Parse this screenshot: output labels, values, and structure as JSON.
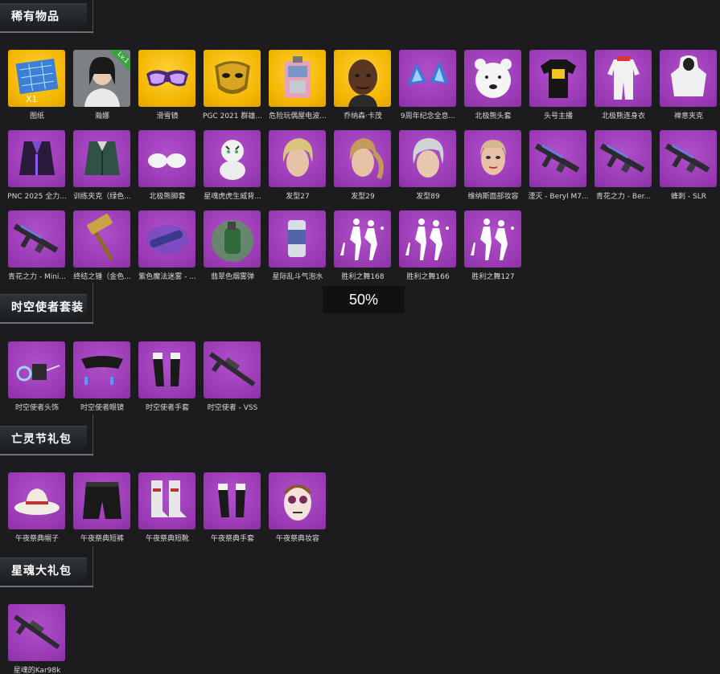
{
  "sections": [
    {
      "title": "稀有物品",
      "items": [
        {
          "label": "图纸",
          "bg": "gold",
          "icon": "blueprint-icon",
          "qty": "X1"
        },
        {
          "label": "瀚娜",
          "bg": "gray",
          "icon": "character-portrait-icon",
          "badge": "Lv.1"
        },
        {
          "label": "滑雪镜",
          "bg": "gold",
          "icon": "goggles-icon"
        },
        {
          "label": "PGC 2021 群雄...",
          "bg": "gold",
          "icon": "gold-mask-icon"
        },
        {
          "label": "危险玩偶屋电波...",
          "bg": "gold",
          "icon": "backpack-icon"
        },
        {
          "label": "乔纳森·卡茂",
          "bg": "gold",
          "icon": "character-face-icon"
        },
        {
          "label": "9周年纪念全息...",
          "bg": "purple",
          "icon": "cat-ears-icon"
        },
        {
          "label": "北极熊头套",
          "bg": "purple",
          "icon": "polar-bear-head-icon"
        },
        {
          "label": "头号主播",
          "bg": "purple",
          "icon": "tshirt-icon"
        },
        {
          "label": "北极熊连身衣",
          "bg": "purple",
          "icon": "jumpsuit-icon"
        },
        {
          "label": "禅意夹克",
          "bg": "purple",
          "icon": "hooded-jacket-icon"
        },
        {
          "label": "PNC 2025 全力...",
          "bg": "purple",
          "icon": "jacket-icon"
        },
        {
          "label": "训练夹克（绿色...",
          "bg": "purple",
          "icon": "green-jacket-icon"
        },
        {
          "label": "北极熊脚套",
          "bg": "purple",
          "icon": "paw-shoes-icon"
        },
        {
          "label": "星魂虎虎生威背...",
          "bg": "purple",
          "icon": "tiger-plush-icon"
        },
        {
          "label": "发型27",
          "bg": "purple",
          "icon": "hair-blonde-icon"
        },
        {
          "label": "发型29",
          "bg": "purple",
          "icon": "hair-ponytail-icon"
        },
        {
          "label": "发型89",
          "bg": "purple",
          "icon": "hair-silver-icon"
        },
        {
          "label": "维纳斯面部妆容",
          "bg": "purple",
          "icon": "face-makeup-icon"
        },
        {
          "label": "湮灭 - Beryl M7...",
          "bg": "purple",
          "icon": "rifle-icon"
        },
        {
          "label": "青花之力 - Ber...",
          "bg": "purple",
          "icon": "rifle-icon"
        },
        {
          "label": "蜂刺 - SLR",
          "bg": "purple",
          "icon": "rifle-icon"
        },
        {
          "label": "青花之力 - Mini...",
          "bg": "purple",
          "icon": "rifle-icon"
        },
        {
          "label": "终结之锤（金色...",
          "bg": "purple",
          "icon": "hammer-icon"
        },
        {
          "label": "紫色魔法迷雾 - ...",
          "bg": "purple",
          "icon": "magic-gun-icon"
        },
        {
          "label": "翡翠色烟雾弹",
          "bg": "purple",
          "icon": "smoke-grenade-icon"
        },
        {
          "label": "星际乱斗气泡水",
          "bg": "purple",
          "icon": "soda-can-icon"
        },
        {
          "label": "胜利之舞168",
          "bg": "purple",
          "icon": "dance-emote-icon"
        },
        {
          "label": "胜利之舞166",
          "bg": "purple",
          "icon": "dance-emote-icon"
        },
        {
          "label": "胜利之舞127",
          "bg": "purple",
          "icon": "dance-emote-icon"
        }
      ]
    },
    {
      "title": "时空使者套装",
      "items": [
        {
          "label": "时空使者头饰",
          "bg": "purple",
          "icon": "headwear-icon"
        },
        {
          "label": "时空使者眼镜",
          "bg": "purple",
          "icon": "glasses-icon"
        },
        {
          "label": "时空使者手套",
          "bg": "purple",
          "icon": "gloves-icon"
        },
        {
          "label": "时空使者 - VSS",
          "bg": "purple",
          "icon": "sniper-rifle-icon"
        }
      ]
    },
    {
      "title": "亡灵节礼包",
      "items": [
        {
          "label": "午夜祭典帽子",
          "bg": "purple",
          "icon": "hat-icon"
        },
        {
          "label": "午夜祭典短裤",
          "bg": "purple",
          "icon": "shorts-icon"
        },
        {
          "label": "午夜祭典短靴",
          "bg": "purple",
          "icon": "boots-icon"
        },
        {
          "label": "午夜祭典手套",
          "bg": "purple",
          "icon": "gloves-icon"
        },
        {
          "label": "午夜祭典妆容",
          "bg": "purple",
          "icon": "skull-makeup-icon"
        }
      ]
    },
    {
      "title": "星魂大礼包",
      "items": [
        {
          "label": "星魂的Kar98k",
          "bg": "purple",
          "icon": "sniper-rifle-icon"
        }
      ]
    }
  ],
  "progress_text": "50%"
}
